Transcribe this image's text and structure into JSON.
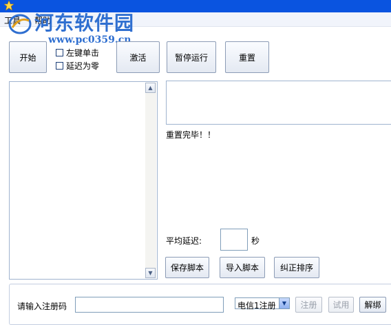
{
  "menubar": {
    "tools": "工具",
    "help": "帮助"
  },
  "watermark": {
    "name": "河东软件园",
    "url": "www.pc0359.cn"
  },
  "toolbar": {
    "start_label": "开始",
    "left_click_label": "左键单击",
    "delay_zero_label": "延迟为零",
    "activate_label": "激活",
    "pause_label": "暂停运行",
    "reset_label": "重置"
  },
  "log": {
    "status_text": "重置完毕！！"
  },
  "delay": {
    "label": "平均延迟:",
    "value": "",
    "unit": "秒"
  },
  "actions": {
    "save_label": "保存脚本",
    "import_label": "导入脚本",
    "fix_order_label": "纠正排序"
  },
  "register": {
    "prompt": "请输入注册码",
    "code_value": "",
    "carrier_selected": "电信1注册",
    "register_label": "注册",
    "trial_label": "试用",
    "unbind_label": "解绑"
  }
}
